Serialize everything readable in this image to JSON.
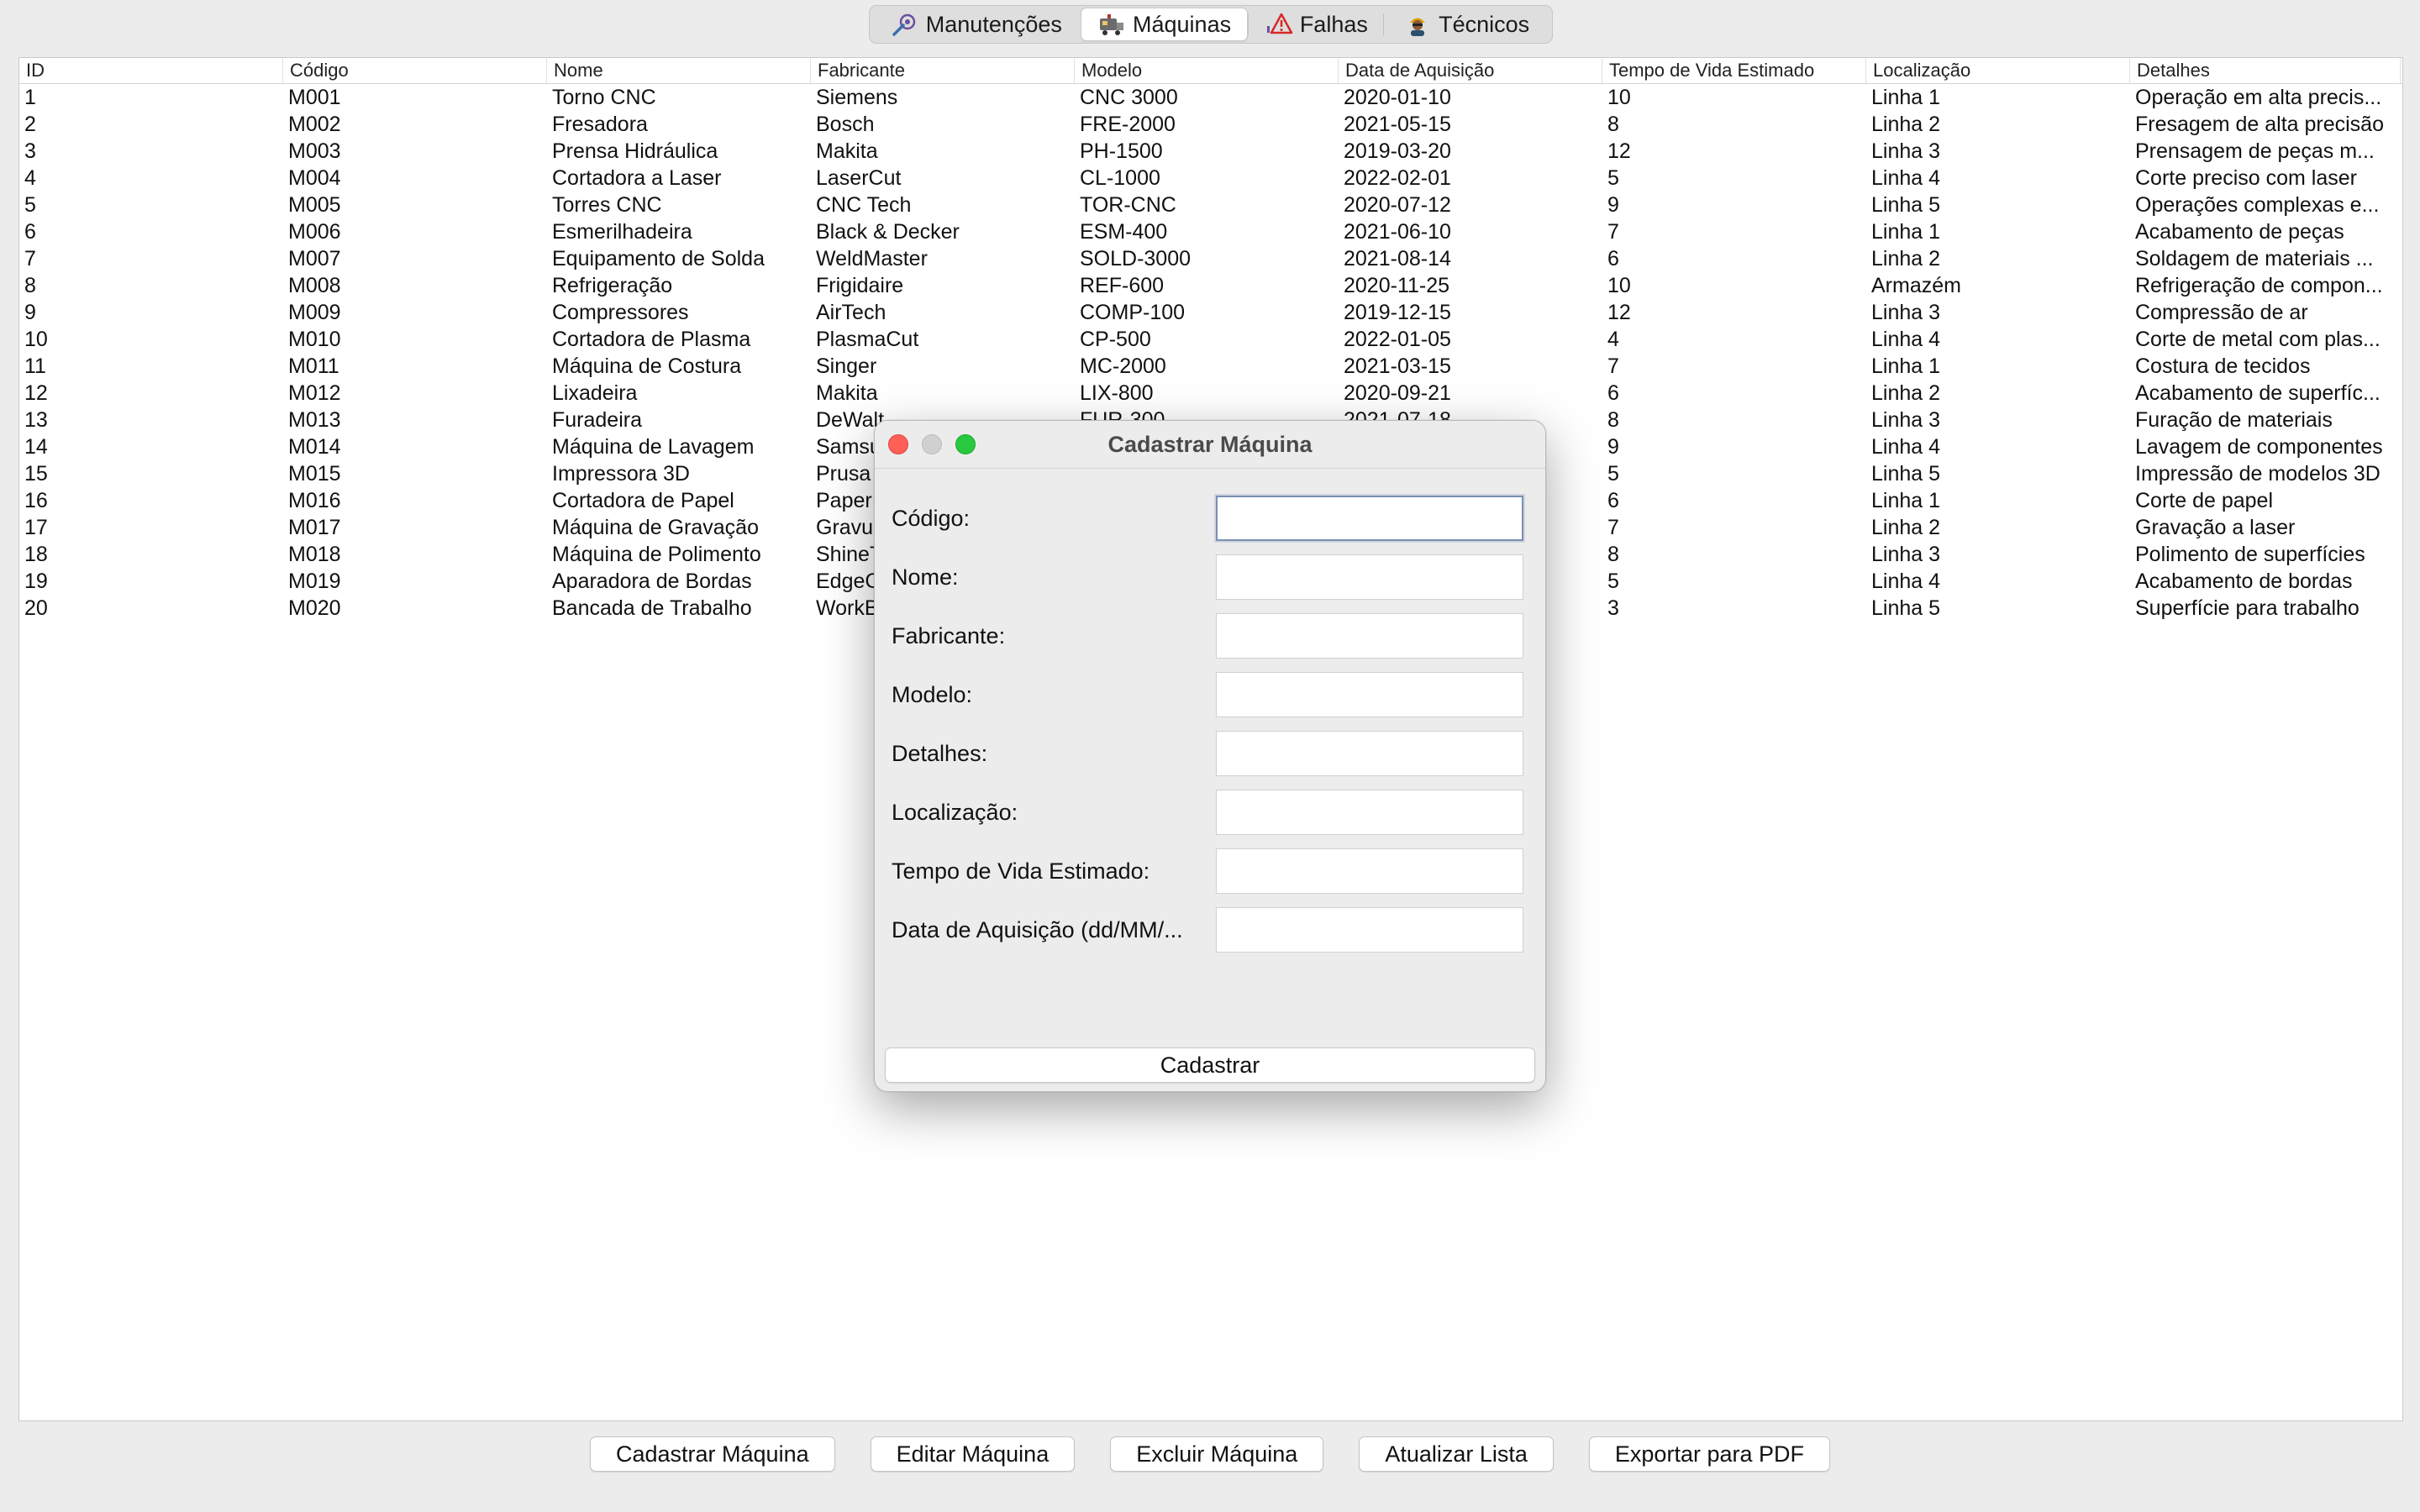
{
  "tabs": [
    {
      "label": "Manutenções",
      "icon": "wrench-gear-icon"
    },
    {
      "label": "Máquinas",
      "icon": "machine-icon"
    },
    {
      "label": "Falhas",
      "icon": "warning-icon"
    },
    {
      "label": "Técnicos",
      "icon": "technician-icon"
    }
  ],
  "active_tab": "Máquinas",
  "table": {
    "columns": [
      "ID",
      "Código",
      "Nome",
      "Fabricante",
      "Modelo",
      "Data de Aquisição",
      "Tempo de Vida Estimado",
      "Localização",
      "Detalhes"
    ],
    "rows": [
      [
        "1",
        "M001",
        "Torno CNC",
        "Siemens",
        "CNC 3000",
        "2020-01-10",
        "10",
        "Linha 1",
        "Operação em alta precis..."
      ],
      [
        "2",
        "M002",
        "Fresadora",
        "Bosch",
        "FRE-2000",
        "2021-05-15",
        "8",
        "Linha 2",
        "Fresagem de alta precisão"
      ],
      [
        "3",
        "M003",
        "Prensa Hidráulica",
        "Makita",
        "PH-1500",
        "2019-03-20",
        "12",
        "Linha 3",
        "Prensagem de peças m..."
      ],
      [
        "4",
        "M004",
        "Cortadora a Laser",
        "LaserCut",
        "CL-1000",
        "2022-02-01",
        "5",
        "Linha 4",
        "Corte preciso com laser"
      ],
      [
        "5",
        "M005",
        "Torres CNC",
        "CNC Tech",
        "TOR-CNC",
        "2020-07-12",
        "9",
        "Linha 5",
        "Operações complexas e..."
      ],
      [
        "6",
        "M006",
        "Esmerilhadeira",
        "Black & Decker",
        "ESM-400",
        "2021-06-10",
        "7",
        "Linha 1",
        "Acabamento de peças"
      ],
      [
        "7",
        "M007",
        "Equipamento de Solda",
        "WeldMaster",
        "SOLD-3000",
        "2021-08-14",
        "6",
        "Linha 2",
        "Soldagem de materiais ..."
      ],
      [
        "8",
        "M008",
        "Refrigeração",
        "Frigidaire",
        "REF-600",
        "2020-11-25",
        "10",
        "Armazém",
        "Refrigeração de compon..."
      ],
      [
        "9",
        "M009",
        "Compressores",
        "AirTech",
        "COMP-100",
        "2019-12-15",
        "12",
        "Linha 3",
        "Compressão de ar"
      ],
      [
        "10",
        "M010",
        "Cortadora de Plasma",
        "PlasmaCut",
        "CP-500",
        "2022-01-05",
        "4",
        "Linha 4",
        "Corte de metal com plas..."
      ],
      [
        "11",
        "M011",
        "Máquina de Costura",
        "Singer",
        "MC-2000",
        "2021-03-15",
        "7",
        "Linha 1",
        "Costura de tecidos"
      ],
      [
        "12",
        "M012",
        "Lixadeira",
        "Makita",
        "LIX-800",
        "2020-09-21",
        "6",
        "Linha 2",
        "Acabamento de superfíc..."
      ],
      [
        "13",
        "M013",
        "Furadeira",
        "DeWalt",
        "FUR-300",
        "2021-07-18",
        "8",
        "Linha 3",
        "Furação de materiais"
      ],
      [
        "14",
        "M014",
        "Máquina de Lavagem",
        "Samsung",
        "",
        "",
        "9",
        "Linha 4",
        "Lavagem de componentes"
      ],
      [
        "15",
        "M015",
        "Impressora 3D",
        "Prusa",
        "",
        "",
        "5",
        "Linha 5",
        "Impressão de modelos 3D"
      ],
      [
        "16",
        "M016",
        "Cortadora de Papel",
        "Paper",
        "",
        "",
        "6",
        "Linha 1",
        "Corte de papel"
      ],
      [
        "17",
        "M017",
        "Máquina de Gravação",
        "Gravu",
        "",
        "",
        "7",
        "Linha 2",
        "Gravação a laser"
      ],
      [
        "18",
        "M018",
        "Máquina de Polimento",
        "ShineT",
        "",
        "",
        "8",
        "Linha 3",
        "Polimento de superfícies"
      ],
      [
        "19",
        "M019",
        "Aparadora de Bordas",
        "EdgeC",
        "",
        "",
        "5",
        "Linha 4",
        "Acabamento de bordas"
      ],
      [
        "20",
        "M020",
        "Bancada de Trabalho",
        "WorkB",
        "",
        "",
        "3",
        "Linha 5",
        "Superfície para trabalho"
      ]
    ]
  },
  "buttons": {
    "cadastrar": "Cadastrar Máquina",
    "editar": "Editar Máquina",
    "excluir": "Excluir Máquina",
    "atualizar": "Atualizar Lista",
    "exportar": "Exportar para PDF"
  },
  "dialog": {
    "title": "Cadastrar Máquina",
    "fields": [
      {
        "label": "Código:",
        "value": ""
      },
      {
        "label": "Nome:",
        "value": ""
      },
      {
        "label": "Fabricante:",
        "value": ""
      },
      {
        "label": "Modelo:",
        "value": ""
      },
      {
        "label": "Detalhes:",
        "value": ""
      },
      {
        "label": "Localização:",
        "value": ""
      },
      {
        "label": "Tempo de Vida Estimado:",
        "value": ""
      },
      {
        "label": "Data de Aquisição (dd/MM/...",
        "value": ""
      }
    ],
    "submit_label": "Cadastrar"
  },
  "colors": {
    "window_bg": "#ececec",
    "close": "#fe5f57",
    "zoom": "#28c840",
    "focus_ring": "#7a8fb4"
  }
}
